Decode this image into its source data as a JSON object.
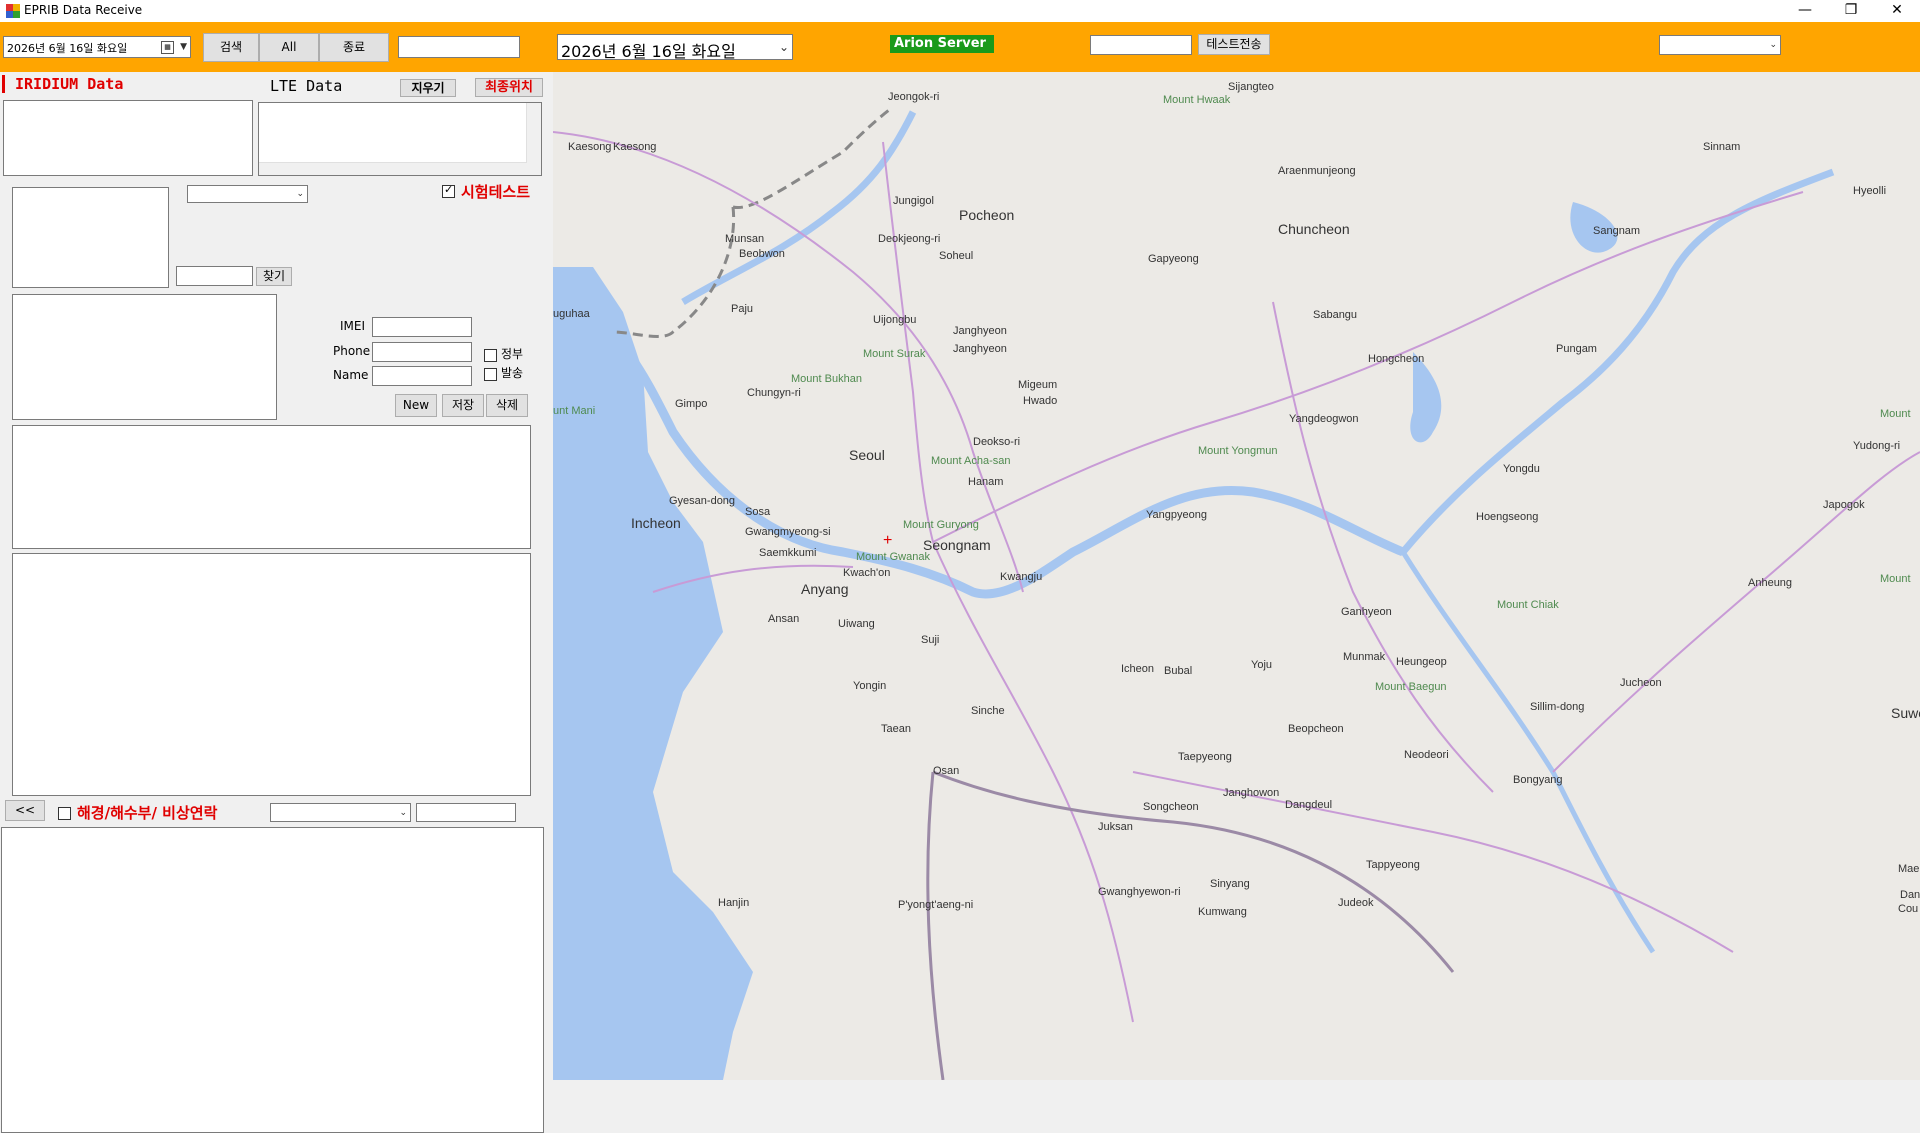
{
  "window": {
    "title": "EPRIB  Data Receive",
    "minimize": "—",
    "restore": "❐",
    "close": "✕"
  },
  "toolbar": {
    "date_picker_value": "2026년   6월 16일 화요일",
    "search_label": "검색",
    "all_label": "All",
    "end_label": "종료",
    "search_input_value": "",
    "big_date_value": "2026년   6월 16일 화요일",
    "server_badge": "Arion Server",
    "server_badge_color": "#1a9a1a",
    "test_input_value": "",
    "test_send_label": "테스트전송",
    "right_combo_value": "",
    "toolbar_color": "#ffa500"
  },
  "left": {
    "iridium_label": "IRIDIUM Data",
    "lte_label": "LTE Data",
    "clear_label": "지우기",
    "last_location_label": "최종위치",
    "test_checkbox_label": "시험테스트",
    "test_checked": true,
    "find_input_value": "",
    "find_label": "찾기",
    "combo_value": "",
    "imei_label": "IMEI",
    "phone_label": "Phone",
    "name_label": "Name",
    "imei_value": "",
    "phone_value": "",
    "name_value": "",
    "jeongbu_label": "정부",
    "balsong_label": "발송",
    "new_label": "New",
    "save_label": "저장",
    "delete_label": "삭제",
    "back_label": "<<",
    "emergency_label": "해경/해수부/ 비상연락",
    "emergency_combo_value": "",
    "emergency_input_value": ""
  },
  "map": {
    "water_color": "#a6c6f0",
    "land_color": "#eceae6",
    "road_color": "#c89bd6",
    "marker_symbol": "+",
    "places": [
      "Jeongok-ri",
      "Sijangteo",
      "Mount Hwaak",
      "Kaesong",
      "Kaesong",
      "Sinnam",
      "Araenmunjeong",
      "Hyeolli",
      "Jungigol",
      "Pocheon",
      "Munsan",
      "Beobwon",
      "Deokjeong-ri",
      "Soheul",
      "Chuncheon",
      "Sangnam",
      "Gapyeong",
      "uguhaa",
      "Paju",
      "Uijongbu",
      "Janghyeon",
      "Janghyeon",
      "Sabangu",
      "Mount Surak",
      "Hongcheon",
      "Pungam",
      "Mount Bukhan",
      "Migeum",
      "Hwado",
      "Chungyn-ri",
      "Gimpo",
      "unt Mani",
      "Yangdeogwon",
      "Mount",
      "Seoul",
      "Deokso-ri",
      "Mount Yongmun",
      "Yudong-ri",
      "Mount Acha-san",
      "Hanam",
      "Yongdu",
      "Gyesan-dong",
      "Sosa",
      "Incheon",
      "Gwangmyeong-si",
      "Mount Guryong",
      "Yangpyeong",
      "Hoengseong",
      "Japogok",
      "Saemkkumi",
      "Seongnam",
      "Mount Gwanak",
      "Kwach'on",
      "Anyang",
      "Kwangju",
      "Anheung",
      "Mount",
      "Ganhyeon",
      "Mount Chiak",
      "Ansan",
      "Uiwang",
      "Suji",
      "Munmak",
      "Heungeop",
      "Jucheon",
      "Icheon",
      "Bubal",
      "Yoju",
      "Mount Baegun",
      "Sillim-dong",
      "Suwon",
      "Yongin",
      "Sinche",
      "Taean",
      "Beopcheon",
      "Neodeori",
      "Taepyeong",
      "Osan",
      "Bongyang",
      "Janghowon",
      "Songcheon",
      "Dangdeul",
      "Juksan",
      "Tappyeong",
      "Maep",
      "Gwanghyewon-ri",
      "Sinyang",
      "Dany",
      "Cou",
      "Hanjin",
      "P'yongt'aeng-ni",
      "Judeok",
      "Kumwang"
    ]
  }
}
